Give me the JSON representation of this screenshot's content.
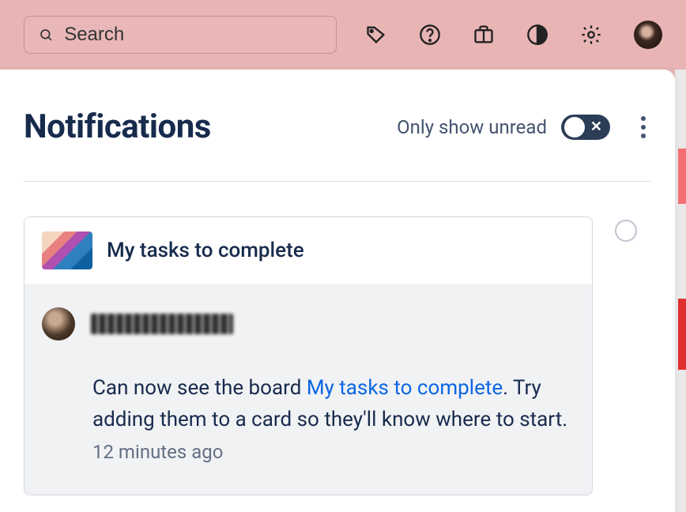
{
  "search": {
    "placeholder": "Search"
  },
  "panel": {
    "title": "Notifications",
    "unread_label": "Only show unread",
    "toggle_on": false
  },
  "notification": {
    "board_title": "My tasks to complete",
    "user_name": "██████████",
    "body_prefix": "Can now see the board ",
    "body_link": "My tasks to complete",
    "body_after_link": ". Try adding them to a card so they'll know where to start. ",
    "timestamp": "12 minutes ago"
  },
  "icons": {
    "tag": "tag-icon",
    "help": "help-icon",
    "briefcase": "briefcase-icon",
    "contrast": "contrast-icon",
    "settings": "settings-icon"
  }
}
